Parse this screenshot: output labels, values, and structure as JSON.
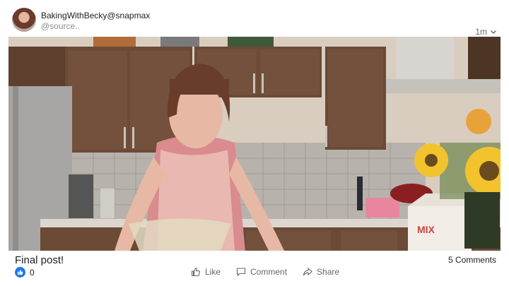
{
  "post": {
    "author": "BakingWithBecky@snapmax",
    "handle": "@source..",
    "time": "1m",
    "caption": "Final post!",
    "reaction_count": "0",
    "comments_count": "5 Comments"
  },
  "actions": {
    "like": "Like",
    "comment": "Comment",
    "share": "Share"
  },
  "video": {
    "package_text": "MIX",
    "colors": {
      "cabinet": "#6b4a36",
      "tile": "#b8b2ad",
      "counter": "#dcd6cf",
      "apron": "#e9b8b0",
      "shirt": "#d98b8e",
      "hair": "#6a3c2a",
      "sunflower": "#f2c32c",
      "accent": "#1877f2"
    }
  }
}
